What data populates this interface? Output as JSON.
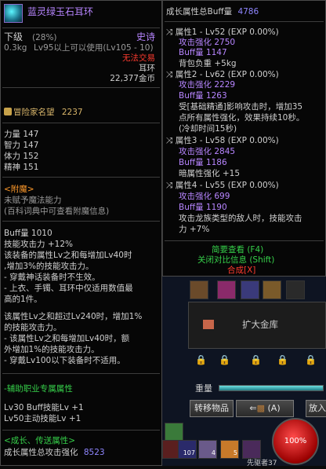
{
  "left": {
    "item_name": "蓝灵绿玉石耳环",
    "grade_label": "下级",
    "grade_percent": "(28%)",
    "rarity": "史诗",
    "weight": "0.3kg",
    "level_req": "Lv95以上可以使用(Lv105 - 10)",
    "trade": "无法交易",
    "slot_type": "耳环",
    "price": "22,377金币",
    "reputation_label": "冒险家名望",
    "reputation_value": "2237",
    "stats": [
      {
        "name": "力量",
        "value": "147"
      },
      {
        "name": "智力",
        "value": "147"
      },
      {
        "name": "体力",
        "value": "152"
      },
      {
        "name": "精神",
        "value": "151"
      }
    ],
    "enchant_title": "<附魔>",
    "enchant_line1": "未赋予魔法能力",
    "enchant_line2": "(百科词典中可查看附魔信息)",
    "buff_line": "Buff量 1010",
    "skill_atk": "技能攻击力 +12%",
    "desc1": [
      "该装备的属性Lv之和每增加Lv40时",
      ",增加3%的技能攻击力。",
      "- 穿戴神话装备时不生效。",
      "- 上衣、手镯、耳环中仅适用数值最",
      "高的1件。"
    ],
    "desc2": [
      "该属性Lv之和超过Lv240时，增加1%",
      "的技能攻击力。",
      "- 该属性Lv之和每增加Lv40时，额",
      "外增加1%的技能攻击力。",
      "- 穿戴Lv100以下装备时不适用。"
    ],
    "aux_title": "-辅助职业专属属性",
    "aux_lines": [
      "Lv30 Buff技能Lv +1",
      "Lv50主动技能Lv +1"
    ],
    "growth_title": "<成长、传送属性>",
    "growth_total_label": "成长属性总攻击强化",
    "growth_total_value": "8523"
  },
  "right": {
    "header_label": "成长属性总Buff量",
    "header_value": "4786",
    "attrs": [
      {
        "title": "属性1 - Lv52 (EXP 0.00%)",
        "atk": "攻击强化 2750",
        "buff": "Buff量 1147",
        "effect": [
          "背包负重 +5kg"
        ]
      },
      {
        "title": "属性2 - Lv62 (EXP 0.00%)",
        "atk": "攻击强化 2229",
        "buff": "Buff量 1263",
        "effect": [
          "受[基础精通]影响攻击时，增加35",
          "点所有属性强化，效果持续10秒。",
          "(冷却时间15秒)"
        ]
      },
      {
        "title": "属性3 - Lv58 (EXP 0.00%)",
        "atk": "攻击强化 2845",
        "buff": "Buff量 1186",
        "effect": [
          "暗属性强化 +15"
        ]
      },
      {
        "title": "属性4 - Lv55 (EXP 0.00%)",
        "atk": "攻击强化 699",
        "buff": "Buff量 1190",
        "effect": [
          "攻击龙族类型的敌人时，技能攻击",
          "力 +7%"
        ]
      }
    ],
    "simple_view": "简要查看 (F4)",
    "close_compare": "关闭对比信息 (Shift)",
    "compose": "合成[X]"
  },
  "hud": {
    "expand_vault": "扩大金库",
    "weight_label": "重量",
    "transfer_button": "转移物品",
    "a_button": "(A)",
    "place_button": "放入",
    "hp_percent": "100%",
    "counter_107": "107",
    "counter_4": "4",
    "counter_5": "5",
    "nameplate": "先驱者37"
  }
}
